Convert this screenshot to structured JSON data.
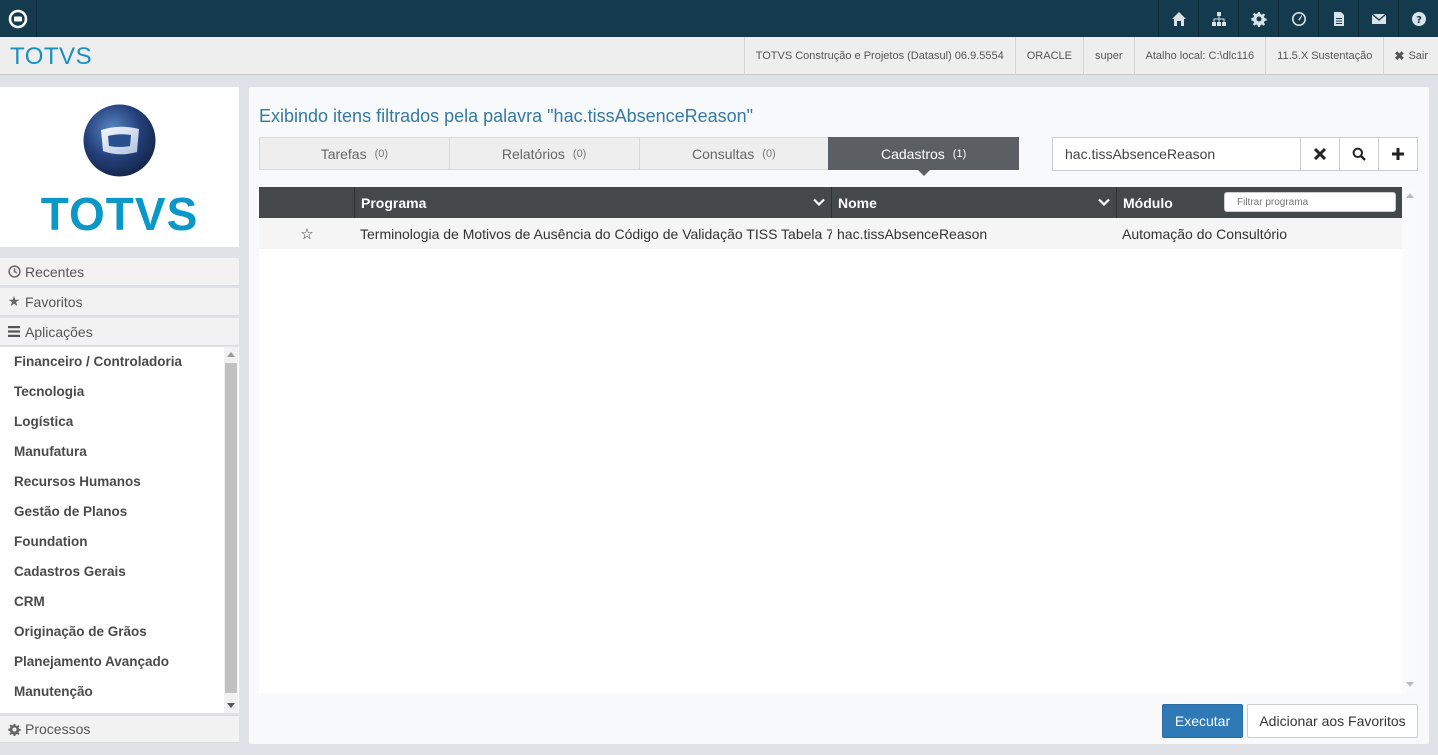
{
  "header": {
    "brand": "TOTVS",
    "product": "TOTVS Construção e Projetos (Datasul) 06.9.5554",
    "database": "ORACLE",
    "user": "super",
    "shortcut": "Atalho local: C:\\dlc116",
    "version": "11.5.X Sustentação",
    "exit_label": "Sair"
  },
  "topbar": {
    "icons": [
      "home-icon",
      "sitemap-icon",
      "gear-icon",
      "dashboard-icon",
      "document-icon",
      "mail-icon",
      "help-icon"
    ]
  },
  "sidebar": {
    "logo_text": "TOTVS",
    "recent_label": "Recentes",
    "favorites_label": "Favoritos",
    "applications_label": "Aplicações",
    "processes_label": "Processos",
    "apps": [
      "Financeiro / Controladoria",
      "Tecnologia",
      "Logística",
      "Manufatura",
      "Recursos Humanos",
      "Gestão de Planos",
      "Foundation",
      "Cadastros Gerais",
      "CRM",
      "Originação de Grãos",
      "Planejamento Avançado",
      "Manutenção"
    ]
  },
  "main": {
    "filter_title": "Exibindo itens filtrados pela palavra \"hac.tissAbsenceReason\"",
    "tabs": [
      {
        "label": "Tarefas",
        "count": "(0)"
      },
      {
        "label": "Relatórios",
        "count": "(0)"
      },
      {
        "label": "Consultas",
        "count": "(0)"
      },
      {
        "label": "Cadastros",
        "count": "(1)"
      }
    ],
    "active_tab": "Cadastros",
    "search_value": "hac.tissAbsenceReason",
    "grid": {
      "columns": [
        "Programa",
        "Nome",
        "Módulo"
      ],
      "filter_placeholder": "Filtrar programa",
      "rows": [
        {
          "favorite": "☆",
          "programa": "Terminologia de Motivos de Ausência do Código de Validação TISS Tabela 7",
          "nome": "hac.tissAbsenceReason",
          "modulo": "Automação do Consultório"
        }
      ]
    },
    "execute_label": "Executar",
    "add_favorites_label": "Adicionar aos Favoritos"
  },
  "colors": {
    "topbar": "#143a4e",
    "brand": "#1a8fc2",
    "active_tab": "#5b5f63",
    "primary_button": "#2f79b6"
  }
}
